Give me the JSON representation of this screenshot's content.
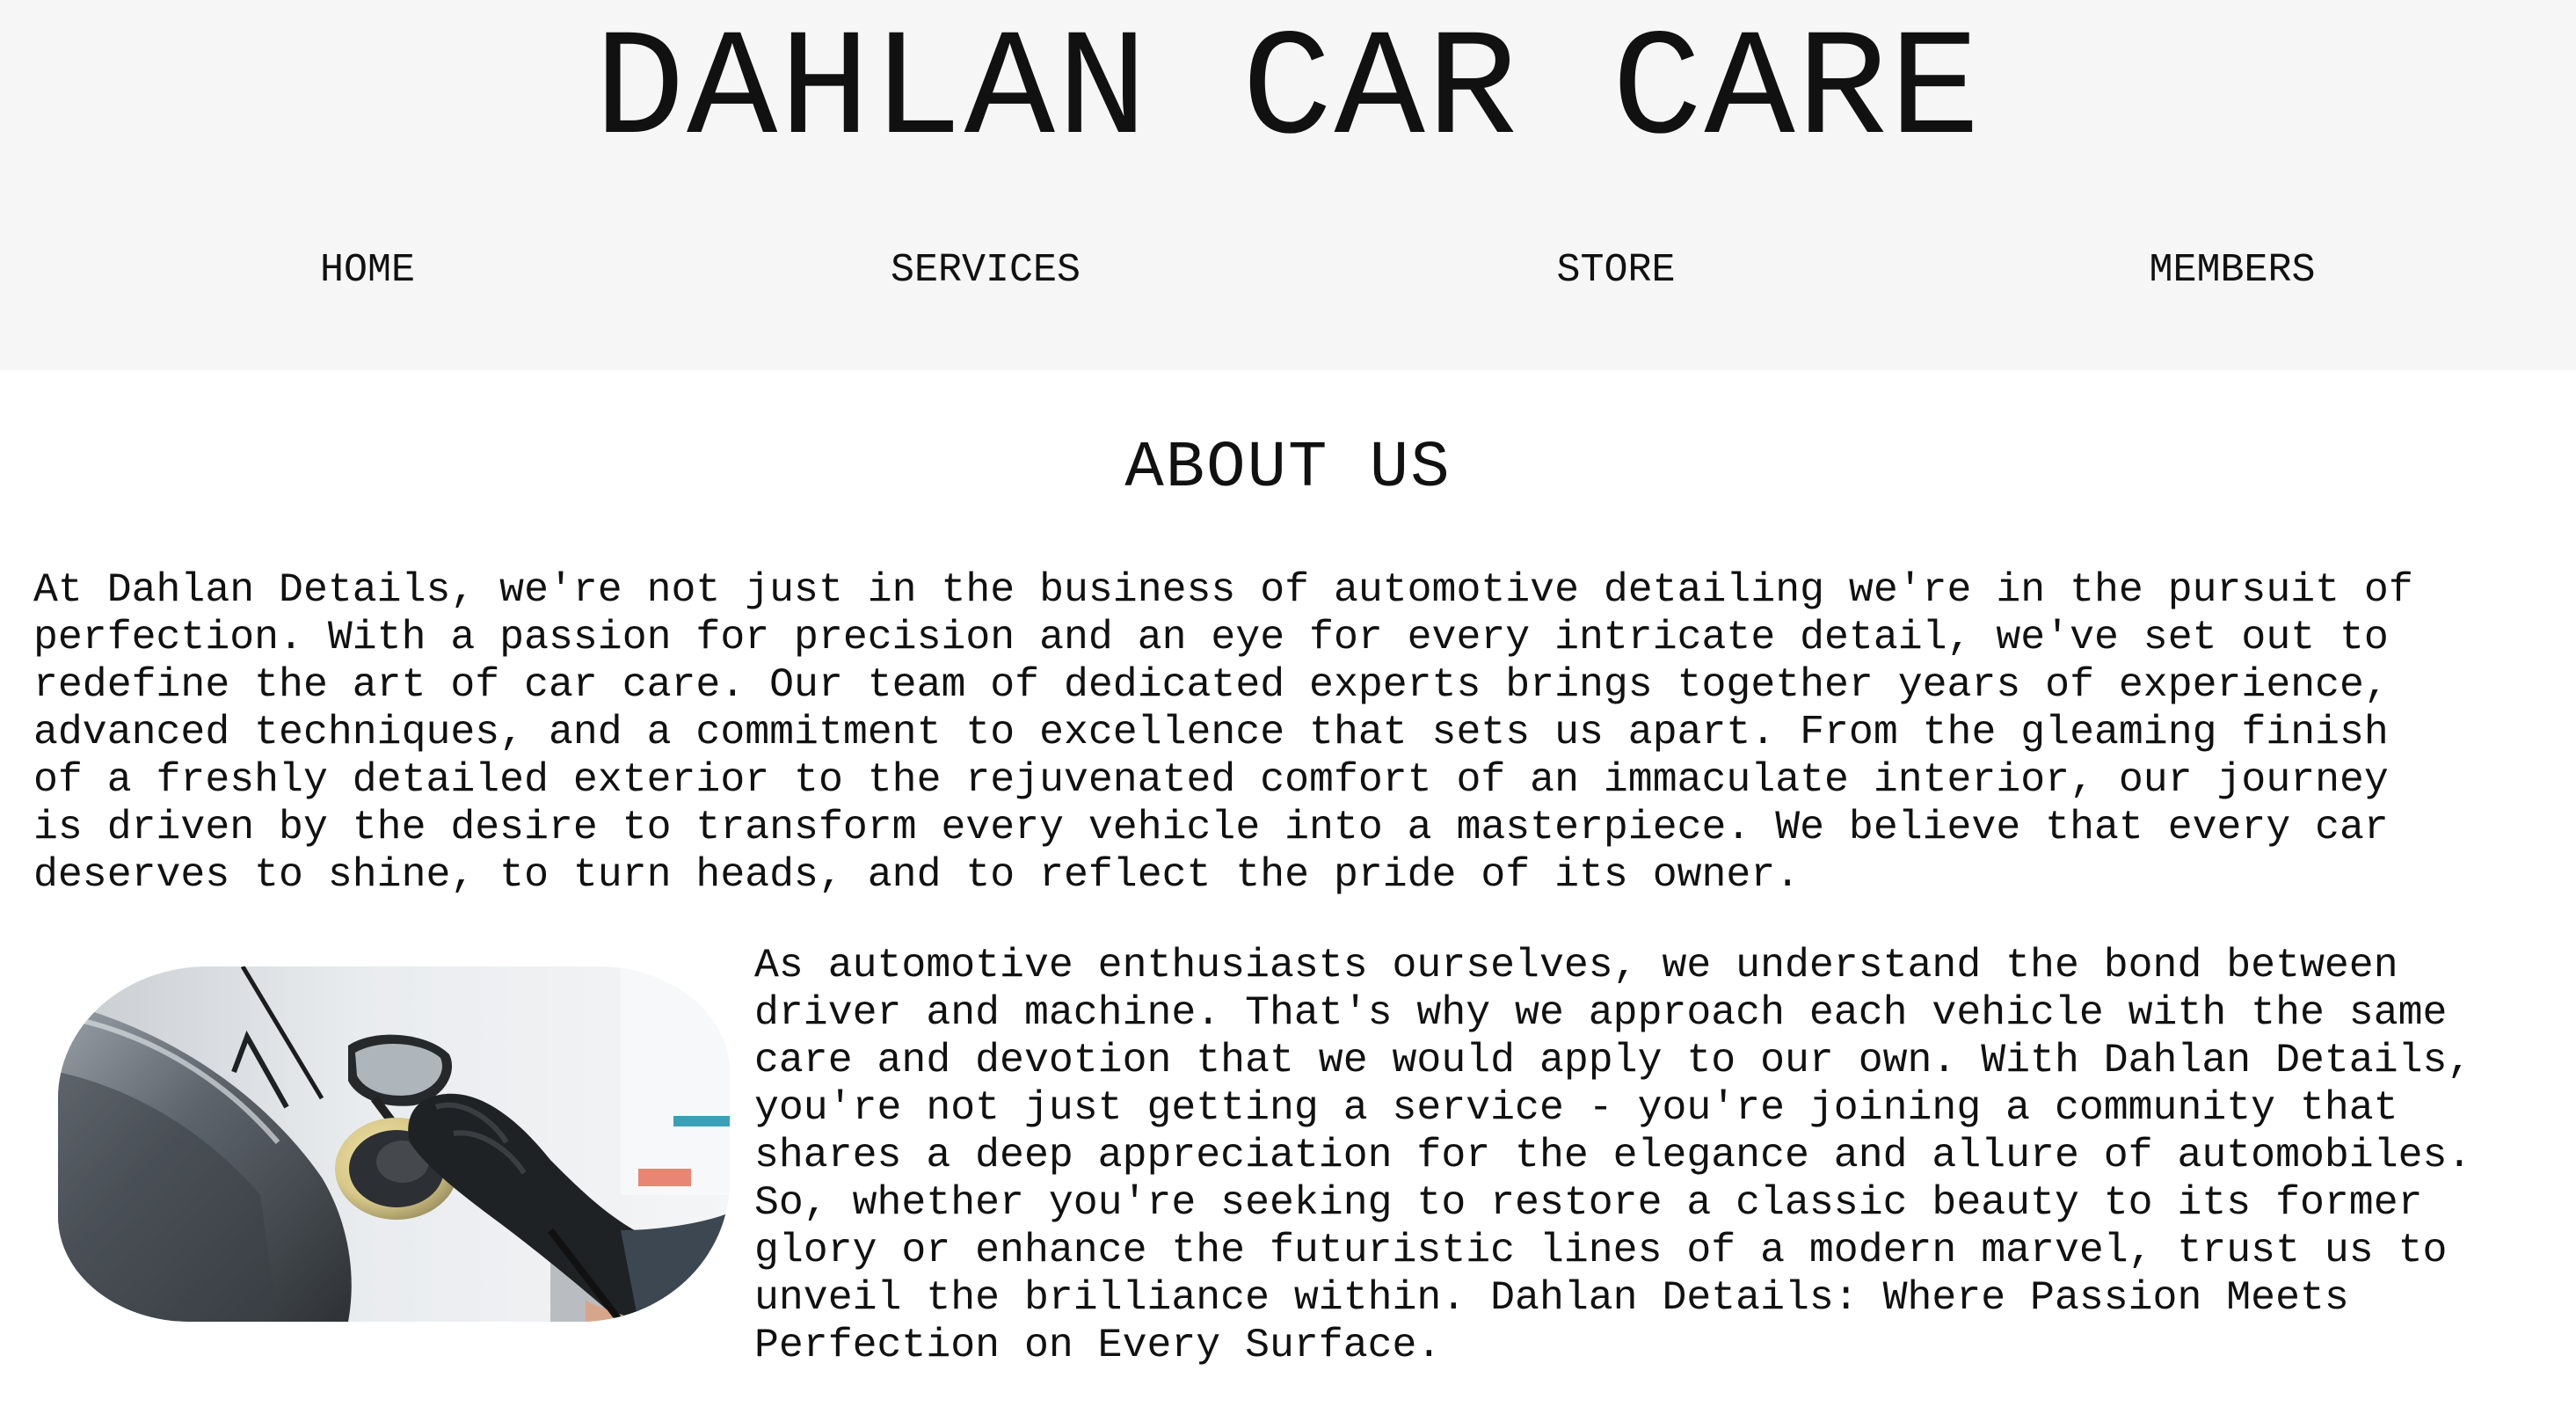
{
  "brand": {
    "title": "DAHLAN CAR CARE"
  },
  "nav": {
    "items": [
      {
        "label": "HOME"
      },
      {
        "label": "SERVICES"
      },
      {
        "label": "STORE"
      },
      {
        "label": "MEMBERS"
      }
    ]
  },
  "about": {
    "title": "ABOUT US",
    "intro_lines": [
      "At Dahlan Details, we're not just in the business of automotive detailing we're in the pursuit of",
      "perfection. With a passion for precision and an eye for every intricate detail, we've set out to",
      "redefine the art of car care. Our team of dedicated experts brings together years of experience,",
      "advanced techniques, and a commitment to excellence that sets us apart. From the gleaming finish",
      "of a freshly detailed exterior to the rejuvenated comfort of an immaculate interior, our journey",
      "is driven by the desire to transform every vehicle into a masterpiece. We believe that every car",
      "deserves to shine, to turn heads, and to reflect the pride of its owner."
    ],
    "second_lines": [
      "As automotive enthusiasts ourselves, we understand the bond between",
      "driver and machine. That's why we approach each vehicle with the same",
      "care and devotion that we would apply to our own. With Dahlan Details,",
      "you're not just getting a service - you're joining a community that",
      "shares a deep appreciation for the elegance and allure of automobiles.",
      "So, whether you're seeking to restore a classic beauty to its former",
      "glory or enhance the futuristic lines of a modern marvel, trust us to",
      "unveil the brilliance within. Dahlan Details: Where Passion Meets",
      "Perfection on Every Surface."
    ],
    "image": {
      "icon": "car-polishing-photo"
    }
  }
}
